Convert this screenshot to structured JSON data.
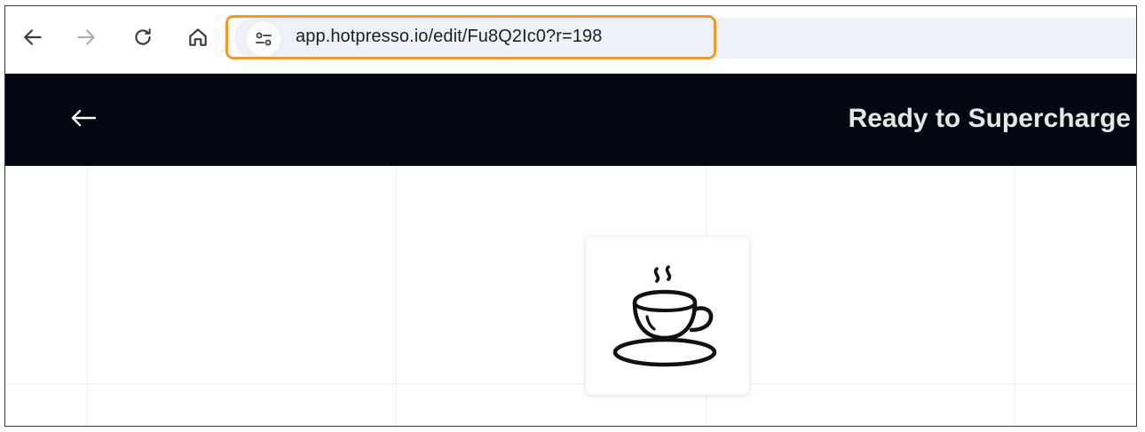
{
  "browser": {
    "url": "app.hotpresso.io/edit/Fu8Q2Ic0?r=198",
    "nav_icons": [
      "back-arrow-icon",
      "forward-arrow-icon",
      "reload-icon",
      "home-icon"
    ],
    "site_info_icon": "tune-icon",
    "highlight_color": "#f09a26"
  },
  "header": {
    "back_icon": "left-arrow-icon",
    "title": "Ready to Supercharge",
    "background": "#030712"
  },
  "canvas": {
    "card_icon": "coffee-cup-icon"
  }
}
